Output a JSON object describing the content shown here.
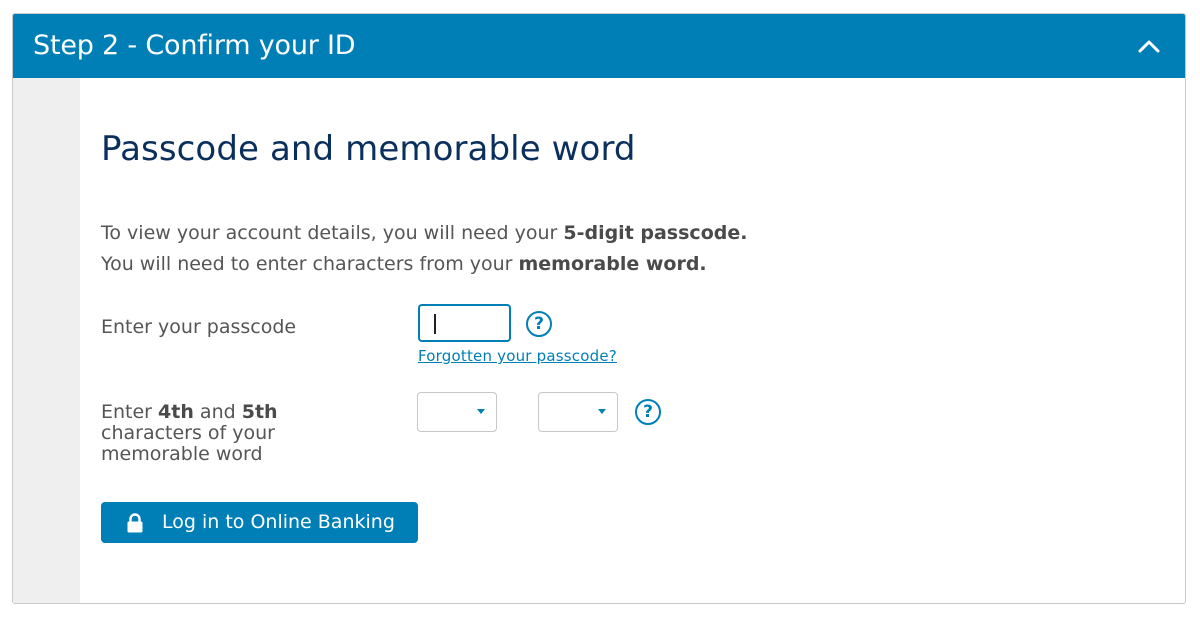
{
  "header": {
    "title": "Step 2 - Confirm your ID",
    "collapse_icon": "chevron-up-icon"
  },
  "main": {
    "heading": "Passcode and memorable word",
    "intro_line1_prefix": "To view your account details, you will need your ",
    "intro_line1_bold": "5-digit passcode.",
    "intro_line2_prefix": "You will need to enter characters from your ",
    "intro_line2_bold": "memorable word.",
    "passcode": {
      "label": "Enter your passcode",
      "value": "",
      "help_icon": "question-icon",
      "forgot_link": "Forgotten your passcode?"
    },
    "memorable": {
      "label_prefix": "Enter ",
      "char1": "4th",
      "label_and": " and ",
      "char2": "5th",
      "label_rest": "characters of your memorable word",
      "select1_value": "",
      "select2_value": "",
      "help_icon": "question-icon"
    },
    "login_button": {
      "label": "Log in to Online Banking",
      "icon": "lock-icon"
    }
  },
  "colors": {
    "brand": "#007fb7",
    "heading": "#0b2f5c",
    "text": "#555555",
    "side_strip": "#efefef"
  }
}
